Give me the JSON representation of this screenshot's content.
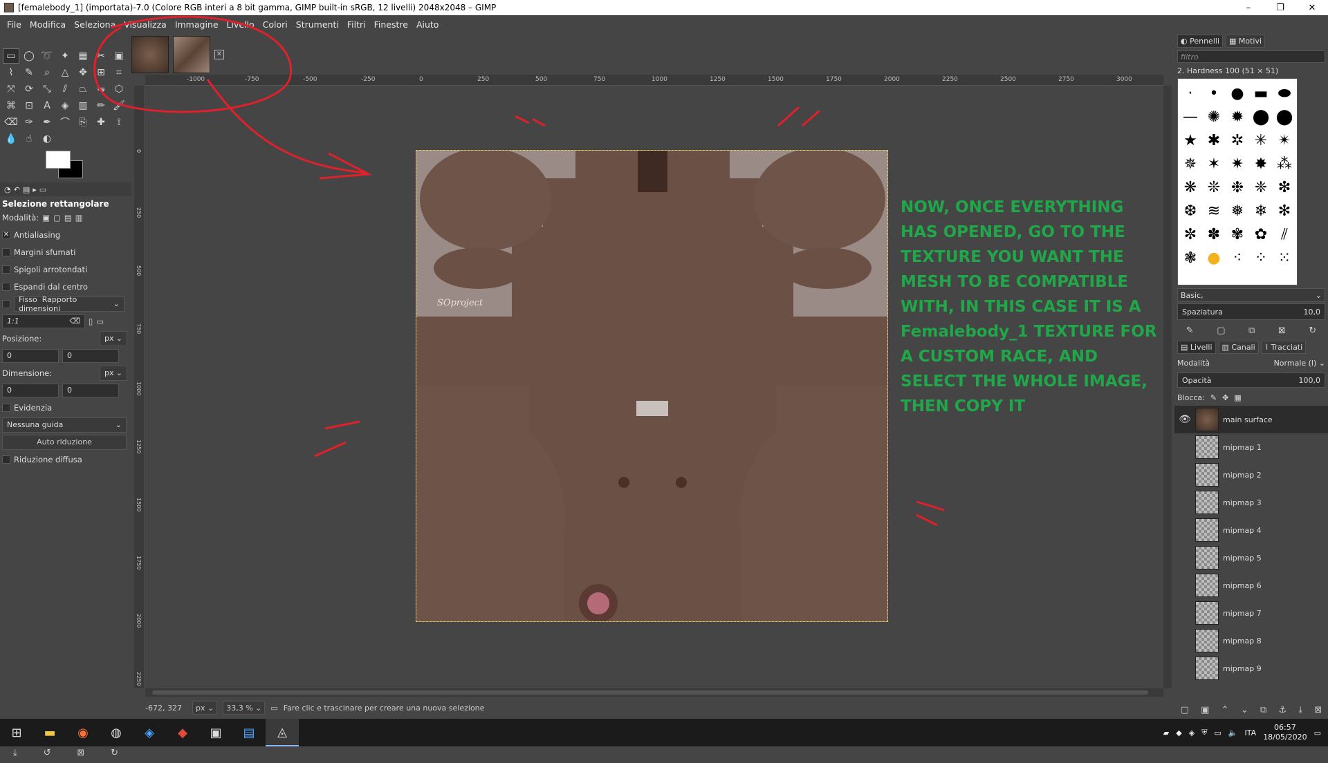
{
  "window": {
    "title": "[femalebody_1] (importata)-7.0 (Colore RGB interi a 8 bit gamma, GIMP built-in sRGB, 12 livelli) 2048x2048 – GIMP",
    "minimize": "–",
    "maximize": "❐",
    "close": "✕"
  },
  "menu": [
    "File",
    "Modifica",
    "Seleziona",
    "Visualizza",
    "Immagine",
    "Livello",
    "Colori",
    "Strumenti",
    "Filtri",
    "Finestre",
    "Aiuto"
  ],
  "toolbox": {
    "tabs_icons": [
      "paint-dynamics-icon",
      "undo-history-icon",
      "images-icon",
      "tool-options-icon",
      "device-status-icon"
    ],
    "options_title": "Selezione rettangolare",
    "mode_label": "Modalità:",
    "antialiasing": "Antialiasing",
    "feather": "Margini sfumati",
    "rounded": "Spigoli arrotondati",
    "expand": "Espandi dal centro",
    "fixed_label": "Fisso",
    "fixed_value": "Rapporto dimensioni",
    "ratio_value": "1:1",
    "position_label": "Posizione:",
    "position_unit": "px",
    "position_x": "0",
    "position_y": "0",
    "size_label": "Dimensione:",
    "size_unit": "px",
    "size_w": "0",
    "size_h": "0",
    "highlight": "Evidenzia",
    "guides_value": "Nessuna guida",
    "auto_shrink": "Auto riduzione",
    "shrink_merged": "Riduzione diffusa"
  },
  "rulers": {
    "h": [
      "-1000",
      "-750",
      "-500",
      "-250",
      "0",
      "250",
      "500",
      "750",
      "1000",
      "1250",
      "1500",
      "1750",
      "2000",
      "2250",
      "2500",
      "2750",
      "3000"
    ],
    "v": [
      "0",
      "250",
      "500",
      "750",
      "1000",
      "1250",
      "1500",
      "1750",
      "2000",
      "2250"
    ]
  },
  "canvas": {
    "watermark": "SOproject",
    "instructions": "NOW, ONCE EVERYTHING HAS OPENED, GO TO THE TEXTURE YOU WANT THE MESH TO BE COMPATIBLE WITH, IN THIS CASE IT IS A Femalebody_1 TEXTURE FOR A CUSTOM RACE, AND SELECT THE WHOLE IMAGE, THEN COPY IT",
    "instruction_color": "#21a64a",
    "annotation_color": "#e0202a"
  },
  "status": {
    "coords": "-672, 327",
    "unit": "px",
    "zoom": "33,3 %",
    "message": "Fare clic e trascinare per creare una nuova selezione"
  },
  "dock": {
    "tab_brushes": "Pennelli",
    "tab_patterns": "Motivi",
    "filter_placeholder": "filtro",
    "brush_name": "2. Hardness 100 (51 × 51)",
    "brush_set": "Basic,",
    "spacing_label": "Spaziatura",
    "spacing_value": "10,0",
    "tab_layers": "Livelli",
    "tab_channels": "Canali",
    "tab_paths": "Tracciati",
    "mode_label": "Modalità",
    "mode_value": "Normale (l)",
    "opacity_label": "Opacità",
    "opacity_value": "100,0",
    "lock_label": "Blocca:",
    "layers": [
      "main surface",
      "mipmap 1",
      "mipmap 2",
      "mipmap 3",
      "mipmap 4",
      "mipmap 5",
      "mipmap 6",
      "mipmap 7",
      "mipmap 8",
      "mipmap 9"
    ]
  },
  "taskbar": {
    "lang": "ITA",
    "time": "06:57",
    "date": "18/05/2020"
  }
}
